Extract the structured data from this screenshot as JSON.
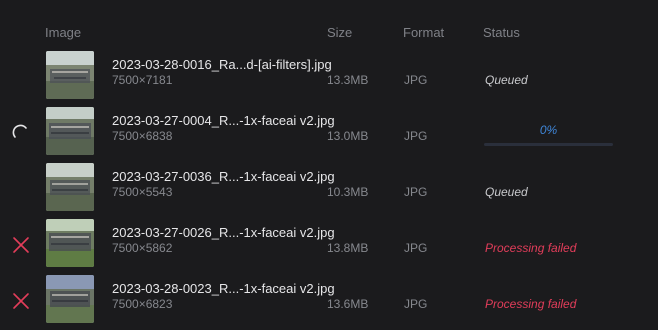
{
  "columns": {
    "image": "Image",
    "size": "Size",
    "format": "Format",
    "status": "Status"
  },
  "rows": [
    {
      "filename": "2023-03-28-0016_Ra...d-[ai-filters].jpg",
      "dimensions": "7500×7181",
      "size": "13.3MB",
      "format": "JPG",
      "status": "Queued",
      "state": "queued",
      "icon": null
    },
    {
      "filename": "2023-03-27-0004_R...-1x-faceai v2.jpg",
      "dimensions": "7500×6838",
      "size": "13.0MB",
      "format": "JPG",
      "status": "0%",
      "state": "processing",
      "progress": 0,
      "icon": "spinner-icon"
    },
    {
      "filename": "2023-03-27-0036_R...-1x-faceai v2.jpg",
      "dimensions": "7500×5543",
      "size": "10.3MB",
      "format": "JPG",
      "status": "Queued",
      "state": "queued",
      "icon": null
    },
    {
      "filename": "2023-03-27-0026_R...-1x-faceai v2.jpg",
      "dimensions": "7500×5862",
      "size": "13.8MB",
      "format": "JPG",
      "status": "Processing failed",
      "state": "failed",
      "icon": "remove-x-icon"
    },
    {
      "filename": "2023-03-28-0023_R...-1x-faceai v2.jpg",
      "dimensions": "7500×6823",
      "size": "13.6MB",
      "format": "JPG",
      "status": "Processing failed",
      "state": "failed",
      "icon": "remove-x-icon"
    }
  ],
  "colors": {
    "background": "#1b1b1d",
    "failed": "#e23d5a",
    "progress": "#3f86d8",
    "queued": "#c9cacd"
  }
}
